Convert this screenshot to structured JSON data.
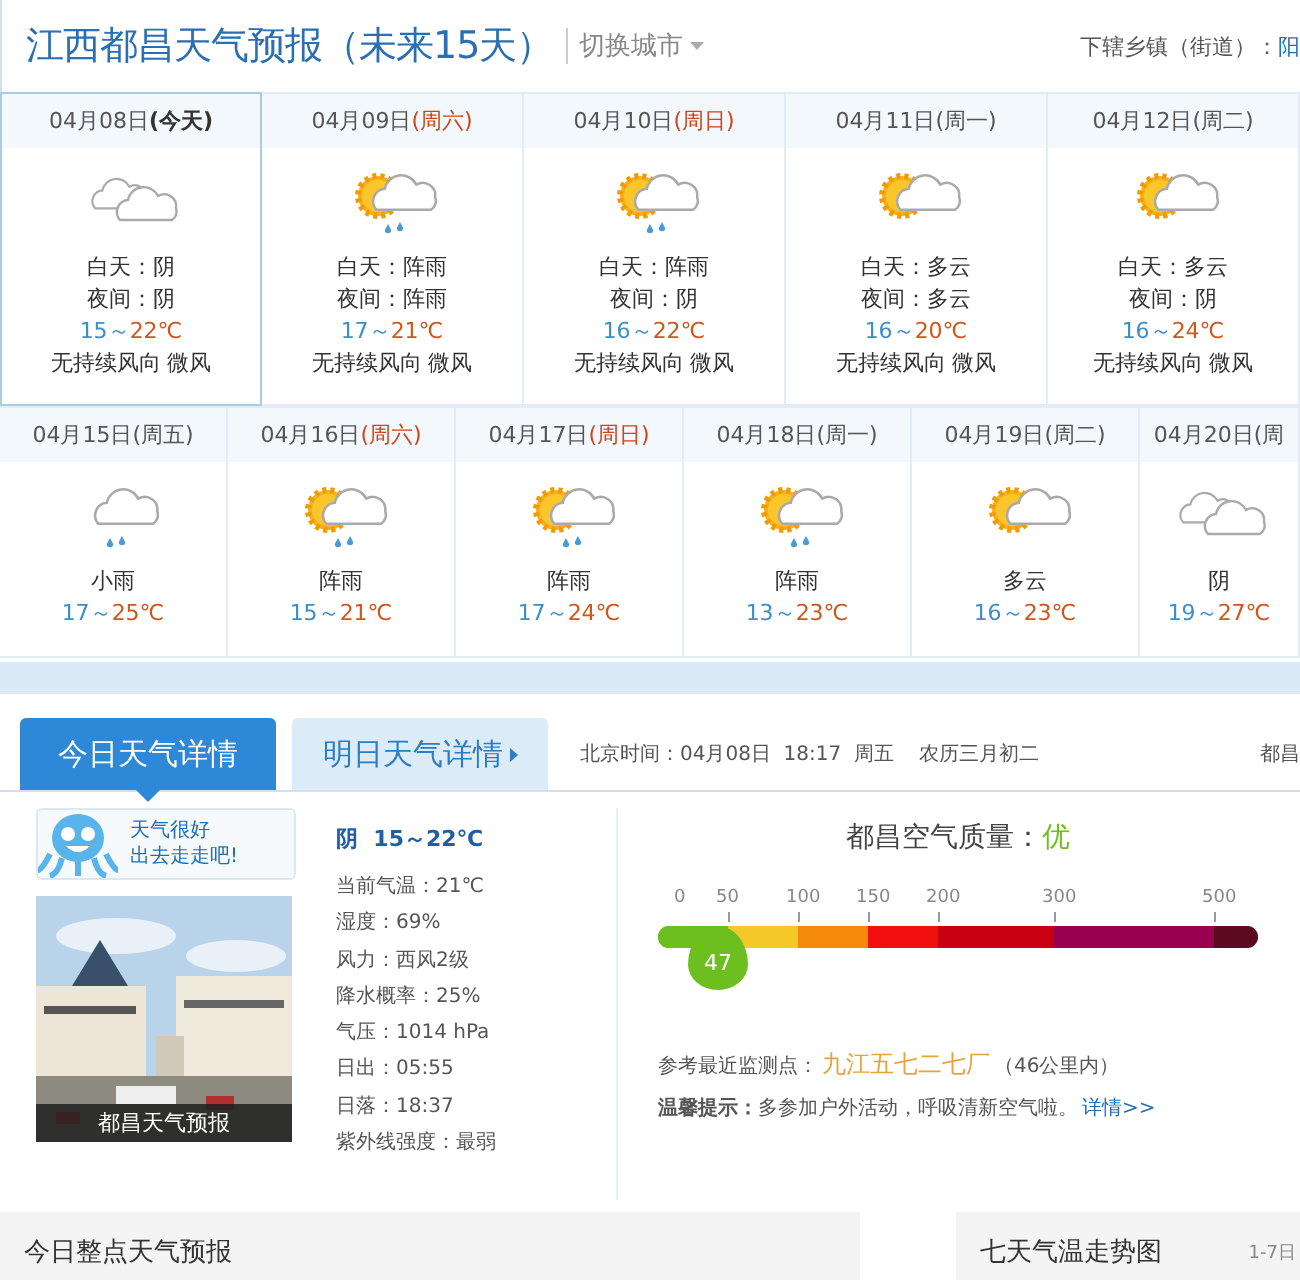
{
  "header": {
    "title": "江西都昌天气预报（未来15天）",
    "switch_city": "切换城市",
    "towns_label": "下辖乡镇（街道）：",
    "towns_first": "阳"
  },
  "week1": [
    {
      "date": "04月08日",
      "weekday": "(今天)",
      "color": "#333333",
      "kind": "overcast",
      "day": "白天：阴",
      "night": "夜间：阴",
      "low": "15～",
      "high": "22℃",
      "wind": "无持续风向 微风",
      "selected": true
    },
    {
      "date": "04月09日",
      "weekday": "(周六)",
      "color": "#d0451b",
      "kind": "showers",
      "day": "白天：阵雨",
      "night": "夜间：阵雨",
      "low": "17～",
      "high": "21℃",
      "wind": "无持续风向 微风",
      "selected": false
    },
    {
      "date": "04月10日",
      "weekday": "(周日)",
      "color": "#d0451b",
      "kind": "showers",
      "day": "白天：阵雨",
      "night": "夜间：阴",
      "low": "16～",
      "high": "22℃",
      "wind": "无持续风向 微风",
      "selected": false
    },
    {
      "date": "04月11日",
      "weekday": "(周一)",
      "color": "#555555",
      "kind": "cloudy",
      "day": "白天：多云",
      "night": "夜间：多云",
      "low": "16～",
      "high": "20℃",
      "wind": "无持续风向 微风",
      "selected": false
    },
    {
      "date": "04月12日",
      "weekday": "(周二)",
      "color": "#555555",
      "kind": "cloudy",
      "day": "白天：多云",
      "night": "夜间：阴",
      "low": "16～",
      "high": "24℃",
      "wind": "无持续风向 微风",
      "selected": false
    }
  ],
  "week2": [
    {
      "date": "04月15日",
      "weekday": "(周五)",
      "color": "#555555",
      "kind": "rain",
      "condition": "小雨",
      "low": "17～",
      "high": "25℃"
    },
    {
      "date": "04月16日",
      "weekday": "(周六)",
      "color": "#d0451b",
      "kind": "showers",
      "condition": "阵雨",
      "low": "15～",
      "high": "21℃"
    },
    {
      "date": "04月17日",
      "weekday": "(周日)",
      "color": "#d0451b",
      "kind": "showers",
      "condition": "阵雨",
      "low": "17～",
      "high": "24℃"
    },
    {
      "date": "04月18日",
      "weekday": "(周一)",
      "color": "#555555",
      "kind": "showers",
      "condition": "阵雨",
      "low": "13～",
      "high": "23℃"
    },
    {
      "date": "04月19日",
      "weekday": "(周二)",
      "color": "#555555",
      "kind": "cloudy",
      "condition": "多云",
      "low": "16～",
      "high": "23℃"
    },
    {
      "date": "04月20日",
      "weekday": "(周",
      "color": "#555555",
      "kind": "overcast",
      "condition": "阴",
      "low": "19～",
      "high": "27℃"
    }
  ],
  "detail_tabs": [
    {
      "label": "今日天气详情",
      "selected": true
    },
    {
      "label": "明日天气详情",
      "selected": false
    }
  ],
  "clock": "北京时间：04月08日  18:17  周五    农历三月初二",
  "region_cut": "都昌",
  "mascot": {
    "line1": "天气很好",
    "line2": "出去走走吧!"
  },
  "photo": {
    "caption": "都昌天气预报"
  },
  "summary": "阴  15～22℃",
  "details": [
    "当前气温：21℃",
    "湿度：69%",
    "风力：西风2级",
    "降水概率：25%",
    "气压：1014 hPa",
    "日出：05:55",
    "日落：18:37",
    "紫外线强度：最弱"
  ],
  "air": {
    "title": "都昌空气质量：",
    "grade": "优",
    "segments": [
      {
        "tick": "0",
        "color": "#6cbf1e"
      },
      {
        "tick": "50",
        "color": "#f5c829"
      },
      {
        "tick": "100",
        "color": "#f58a0a"
      },
      {
        "tick": "150",
        "color": "#f01010"
      },
      {
        "tick": "200",
        "color": "#c80012"
      },
      {
        "tick": "300",
        "color": "#9a0050"
      },
      {
        "tick": "500",
        "color": "#5c0a20"
      }
    ],
    "marker": "47",
    "level": 0.1,
    "station_label": "参考最近监测点：",
    "station": "九江五七二七厂",
    "distance": "（46公里内）",
    "tip": "**温馨提示：**多参加户外活动，呼吸清新空气啦。",
    "tip_link": "详情>>"
  },
  "bottom": {
    "hourly_title": "今日整点天气预报",
    "trend_title": "七天气温走势图",
    "trend_range": "1-7日"
  }
}
